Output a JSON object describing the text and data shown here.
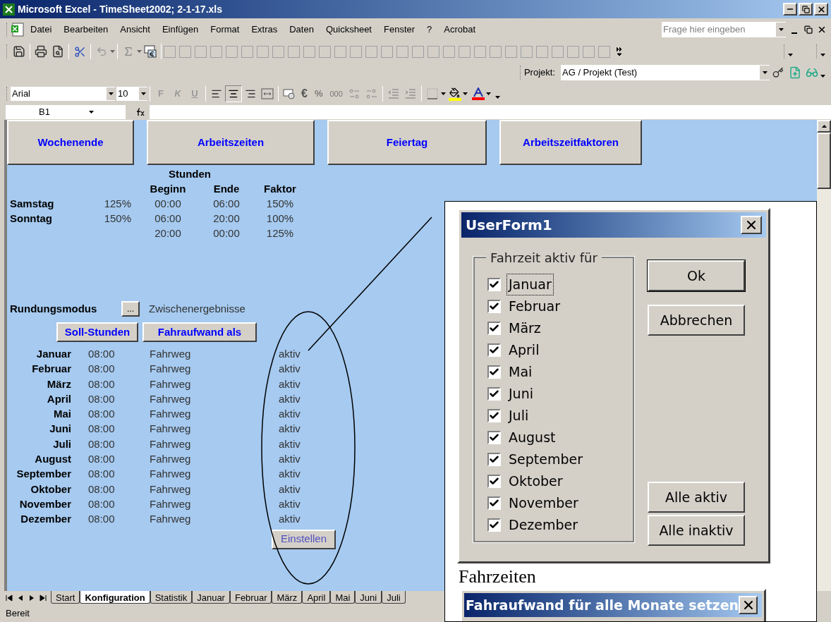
{
  "window": {
    "title": "Microsoft Excel - TimeSheet2002; 2-1-17.xls"
  },
  "menu": [
    {
      "label": "Datei"
    },
    {
      "label": "Bearbeiten"
    },
    {
      "label": "Ansicht"
    },
    {
      "label": "Einfügen"
    },
    {
      "label": "Format"
    },
    {
      "label": "Extras"
    },
    {
      "label": "Daten"
    },
    {
      "label": "Quicksheet"
    },
    {
      "label": "Fenster"
    },
    {
      "label": "?"
    },
    {
      "label": "Acrobat"
    }
  ],
  "help_search": {
    "placeholder": "Frage hier eingeben"
  },
  "project_toolbar": {
    "label": "Projekt:",
    "value": "AG / Projekt (Test)"
  },
  "format_toolbar": {
    "font": "Arial",
    "size": "10",
    "style_buttons": [
      "F",
      "K",
      "U"
    ],
    "number_buttons": [
      "€",
      "%",
      "000"
    ]
  },
  "formula_bar": {
    "cell": "B1"
  },
  "sheet": {
    "top_buttons": [
      "Wochenende",
      "Arbeitszeiten",
      "Feiertag",
      "Arbeitszeitfaktoren"
    ],
    "weekend_table": {
      "group_header": "Stunden",
      "columns": [
        "Beginn",
        "Ende",
        "Faktor"
      ],
      "rows": [
        {
          "day": "Samstag",
          "percent": "125%",
          "begin": "00:00",
          "end": "06:00",
          "factor": "150%"
        },
        {
          "day": "Sonntag",
          "percent": "150%",
          "begin": "06:00",
          "end": "20:00",
          "factor": "100%"
        },
        {
          "begin": "20:00",
          "end": "00:00",
          "factor": "125%"
        }
      ]
    },
    "rounding": {
      "label": "Rundungsmodus",
      "button": "...",
      "value": "Zwischenergebnisse"
    },
    "month_buttons": [
      "Soll-Stunden",
      "Fahraufwand als"
    ],
    "months": [
      {
        "name": "Januar",
        "hours": "08:00",
        "travel": "Fahrweg",
        "status": "aktiv"
      },
      {
        "name": "Februar",
        "hours": "08:00",
        "travel": "Fahrweg",
        "status": "aktiv"
      },
      {
        "name": "März",
        "hours": "08:00",
        "travel": "Fahrweg",
        "status": "aktiv"
      },
      {
        "name": "April",
        "hours": "08:00",
        "travel": "Fahrweg",
        "status": "aktiv"
      },
      {
        "name": "Mai",
        "hours": "08:00",
        "travel": "Fahrweg",
        "status": "aktiv"
      },
      {
        "name": "Juni",
        "hours": "08:00",
        "travel": "Fahrweg",
        "status": "aktiv"
      },
      {
        "name": "Juli",
        "hours": "08:00",
        "travel": "Fahrweg",
        "status": "aktiv"
      },
      {
        "name": "August",
        "hours": "08:00",
        "travel": "Fahrweg",
        "status": "aktiv"
      },
      {
        "name": "September",
        "hours": "08:00",
        "travel": "Fahrweg",
        "status": "aktiv"
      },
      {
        "name": "Oktober",
        "hours": "08:00",
        "travel": "Fahrweg",
        "status": "aktiv"
      },
      {
        "name": "November",
        "hours": "08:00",
        "travel": "Fahrweg",
        "status": "aktiv"
      },
      {
        "name": "Dezember",
        "hours": "08:00",
        "travel": "Fahrweg",
        "status": "aktiv"
      }
    ],
    "settings_button": "Einstellen"
  },
  "sheet_tabs": [
    {
      "label": "Start",
      "selected": false
    },
    {
      "label": "Konfiguration",
      "selected": true
    },
    {
      "label": "Statistik",
      "selected": false
    },
    {
      "label": "Januar",
      "selected": false
    },
    {
      "label": "Februar",
      "selected": false
    },
    {
      "label": "März",
      "selected": false
    },
    {
      "label": "April",
      "selected": false
    },
    {
      "label": "Mai",
      "selected": false
    },
    {
      "label": "Juni",
      "selected": false
    },
    {
      "label": "Juli",
      "selected": false
    }
  ],
  "status_bar": "Bereit",
  "userform": {
    "title": "UserForm1",
    "group_title": "Fahrzeit aktiv für",
    "months": [
      {
        "label": "Januar",
        "checked": true,
        "focused": true
      },
      {
        "label": "Februar",
        "checked": true,
        "focused": false
      },
      {
        "label": "März",
        "checked": true,
        "focused": false
      },
      {
        "label": "April",
        "checked": true,
        "focused": false
      },
      {
        "label": "Mai",
        "checked": true,
        "focused": false
      },
      {
        "label": "Juni",
        "checked": true,
        "focused": false
      },
      {
        "label": "Juli",
        "checked": true,
        "focused": false
      },
      {
        "label": "August",
        "checked": true,
        "focused": false
      },
      {
        "label": "September",
        "checked": true,
        "focused": false
      },
      {
        "label": "Oktober",
        "checked": true,
        "focused": false
      },
      {
        "label": "November",
        "checked": true,
        "focused": false
      },
      {
        "label": "Dezember",
        "checked": true,
        "focused": false
      }
    ],
    "buttons": [
      "Ok",
      "Abbrechen"
    ],
    "bulk_buttons": [
      "Alle aktiv",
      "Alle inaktiv"
    ]
  },
  "caption": "Fahrzeiten",
  "second_dialog": {
    "title": "Fahraufwand für alle Monate setzen"
  }
}
